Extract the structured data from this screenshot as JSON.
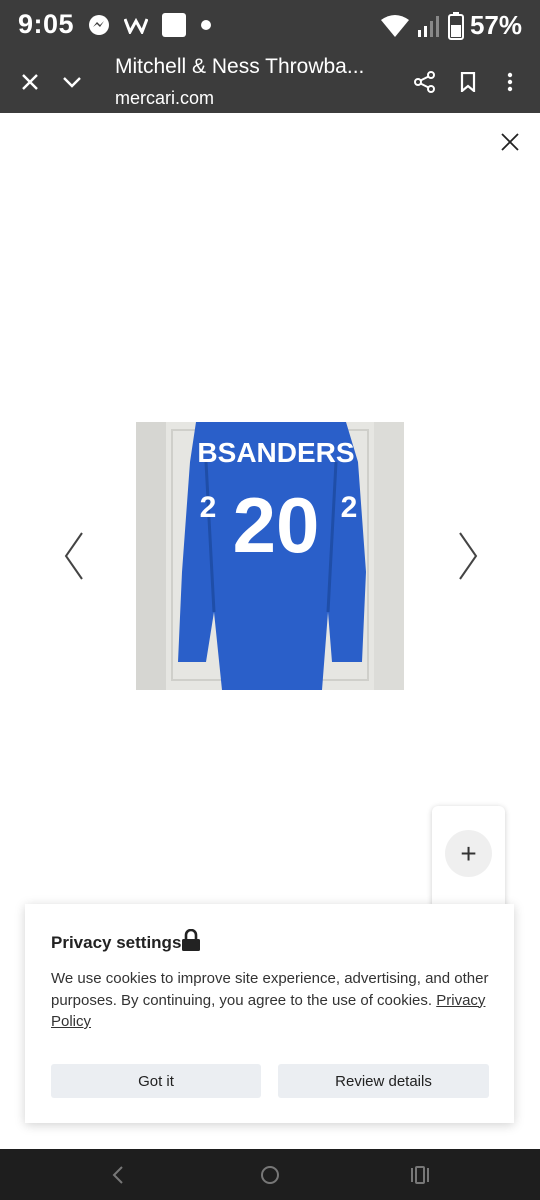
{
  "status_bar": {
    "time": "9:05",
    "battery": "57%",
    "icons": [
      "messenger-icon",
      "w-app-icon",
      "square-app-icon",
      "dot-icon",
      "wifi-icon",
      "signal-icon",
      "battery-icon"
    ]
  },
  "toolbar": {
    "title": "Mitchell & Ness Throwba...",
    "url": "mercari.com",
    "icons": [
      "close-icon",
      "chevron-down-icon",
      "share-icon",
      "bookmark-icon",
      "more-vert-icon"
    ]
  },
  "photo": {
    "jersey_name": "BSANDERS",
    "jersey_number": "20",
    "sleeve_number": "2",
    "colors": {
      "jersey": "#2a5fc9",
      "door": "#e8e8e4"
    }
  },
  "zoom": {
    "in_label": "+"
  },
  "privacy": {
    "title": "Privacy settings",
    "body": "We use cookies to improve site experience, advertising, and other purposes. By continuing, you agree to the use of cookies.",
    "link": "Privacy Policy",
    "got_it": "Got it",
    "review": "Review details"
  }
}
